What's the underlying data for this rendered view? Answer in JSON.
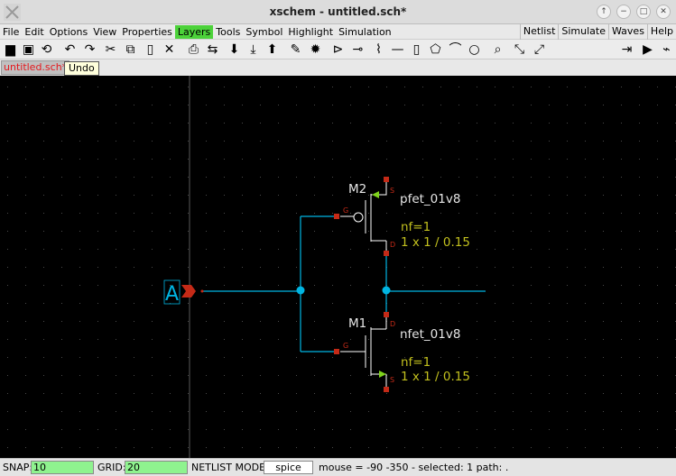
{
  "window": {
    "title": "xschem - untitled.sch*"
  },
  "menu": {
    "items": [
      "File",
      "Edit",
      "Options",
      "View",
      "Properties",
      "Layers",
      "Tools",
      "Symbol",
      "Highlight",
      "Simulation"
    ],
    "active": "Layers",
    "right_items": [
      "Netlist",
      "Simulate",
      "Waves",
      "Help"
    ]
  },
  "tab": {
    "label": "untitled.sch*"
  },
  "tooltip": {
    "text": "Undo"
  },
  "schematic": {
    "pin_label": "A",
    "pmos": {
      "instance": "M2",
      "model": "pfet_01v8",
      "nf": "nf=1",
      "size": "1 x 1 / 0.15"
    },
    "nmos": {
      "instance": "M1",
      "model": "nfet_01v8",
      "nf": "nf=1",
      "size": "1 x 1 / 0.15"
    },
    "pin_letters": {
      "gate": "G",
      "source": "S",
      "drain": "D"
    }
  },
  "status": {
    "snap_label": "SNAP:",
    "snap_value": "10",
    "grid_label": "GRID:",
    "grid_value": "20",
    "netlist_label": "NETLIST MODE:",
    "netlist_value": "spice",
    "info": "mouse = -90 -350 - selected: 1 path: ."
  },
  "colors": {
    "wire": "#00b5e2",
    "pin": "#c42a17",
    "label_yellow": "#c2c01e",
    "active_layer": "#4cd23a",
    "green_arrow": "#7fd31c"
  }
}
